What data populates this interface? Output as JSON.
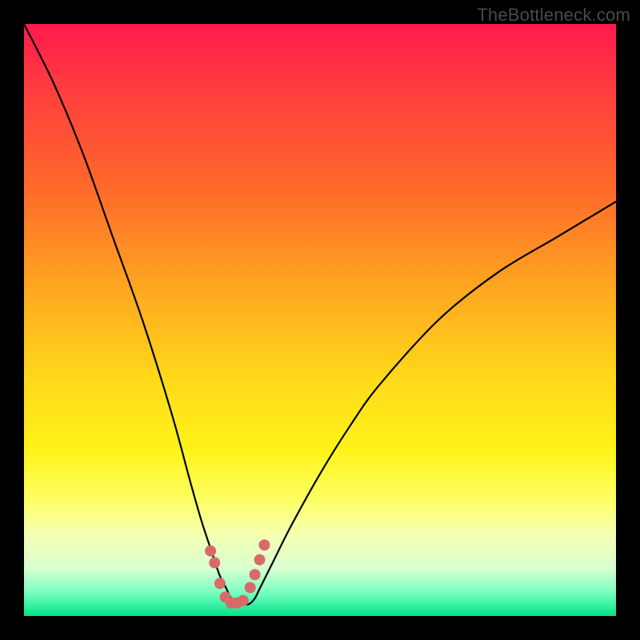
{
  "watermark": "TheBottleneck.com",
  "colors": {
    "background": "#000000",
    "curve": "#000000",
    "dot_fill": "#d86a6a",
    "gradient_top": "#ff1a4d",
    "gradient_bottom": "#00e48a"
  },
  "chart_data": {
    "type": "line",
    "title": "",
    "xlabel": "",
    "ylabel": "",
    "xlim": [
      0,
      100
    ],
    "ylim": [
      0,
      100
    ],
    "grid": false,
    "series": [
      {
        "name": "bottleneck-curve",
        "x": [
          0,
          5,
          10,
          15,
          20,
          25,
          28,
          30,
          32,
          33,
          34,
          35,
          36,
          37,
          38,
          39,
          40,
          42,
          45,
          50,
          55,
          60,
          70,
          80,
          90,
          100
        ],
        "y": [
          100,
          90,
          78,
          64,
          50,
          34,
          23,
          16,
          10,
          7,
          5,
          3,
          2,
          2,
          2,
          3,
          5,
          9,
          15,
          24,
          32,
          39,
          50,
          58,
          64,
          70
        ]
      }
    ],
    "dots": {
      "name": "highlight-dots",
      "x": [
        31.5,
        32.2,
        33.1,
        34.0,
        35.0,
        36.0,
        37.0,
        38.2,
        39.0,
        39.8,
        40.6
      ],
      "y": [
        11.0,
        9.0,
        5.5,
        3.2,
        2.2,
        2.2,
        2.6,
        4.8,
        7.0,
        9.5,
        12.0
      ],
      "r": 7
    }
  }
}
